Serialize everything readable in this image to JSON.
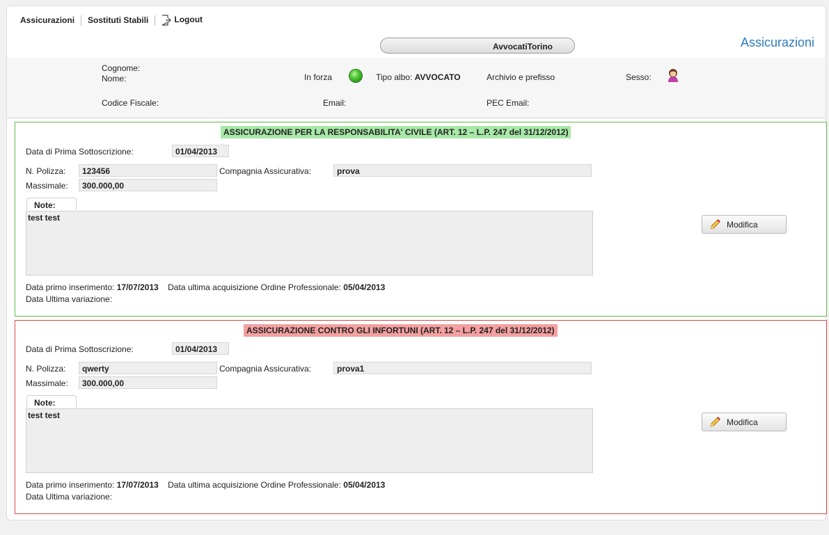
{
  "menu": {
    "items": [
      "Assicurazioni",
      "Sostituti Stabili"
    ],
    "logout": "Logout"
  },
  "header": {
    "pill_text": "AvvocatiTorino",
    "page_title": "Assicurazioni"
  },
  "info": {
    "cognome_label": "Cognome:",
    "nome_label": "Nome:",
    "codice_fiscale_label": "Codice Fiscale:",
    "in_forza_label": "In forza",
    "tipo_albo_label": "Tipo albo:",
    "tipo_albo_value": "AVVOCATO",
    "archivio_label": "Archivio e prefisso",
    "email_label": "Email:",
    "pec_label": "PEC Email:",
    "sesso_label": "Sesso:",
    "status_color": "#3fbf2a"
  },
  "policies": [
    {
      "title": "ASSICURAZIONE PER LA RESPONSABILITA' CIVILE (ART. 12 – L.P. 247 del 31/12/2012)",
      "color": "#5fb84a",
      "prima_sottoscrizione_label": "Data di Prima Sottoscrizione:",
      "prima_sottoscrizione_value": "01/04/2013",
      "polizza_label": "N. Polizza:",
      "polizza_value": "123456",
      "compagnia_label": "Compagnia Assicurativa:",
      "compagnia_value": "prova",
      "massimale_label": "Massimale:",
      "massimale_value": "300.000,00",
      "note_label": "Note:",
      "note_value": "test test",
      "button_label": "Modifica",
      "primo_inserimento_label": "Data primo inserimento:",
      "primo_inserimento_value": "17/07/2013",
      "ultima_acquisizione_label": "Data ultima acquisizione Ordine Professionale:",
      "ultima_acquisizione_value": "05/04/2013",
      "ultima_variazione_label": "Data Ultima variazione:"
    },
    {
      "title": "ASSICURAZIONE CONTRO GLI INFORTUNI (ART. 12 – L.P. 247 del 31/12/2012)",
      "color": "#d84a4a",
      "prima_sottoscrizione_label": "Data di Prima Sottoscrizione:",
      "prima_sottoscrizione_value": "01/04/2013",
      "polizza_label": "N. Polizza:",
      "polizza_value": "qwerty",
      "compagnia_label": "Compagnia Assicurativa:",
      "compagnia_value": "prova1",
      "massimale_label": "Massimale:",
      "massimale_value": "300.000,00",
      "note_label": "Note:",
      "note_value": "test test",
      "button_label": "Modifica",
      "primo_inserimento_label": "Data primo inserimento:",
      "primo_inserimento_value": "17/07/2013",
      "ultima_acquisizione_label": "Data ultima acquisizione Ordine Professionale:",
      "ultima_acquisizione_value": "05/04/2013",
      "ultima_variazione_label": "Data Ultima variazione:"
    }
  ]
}
